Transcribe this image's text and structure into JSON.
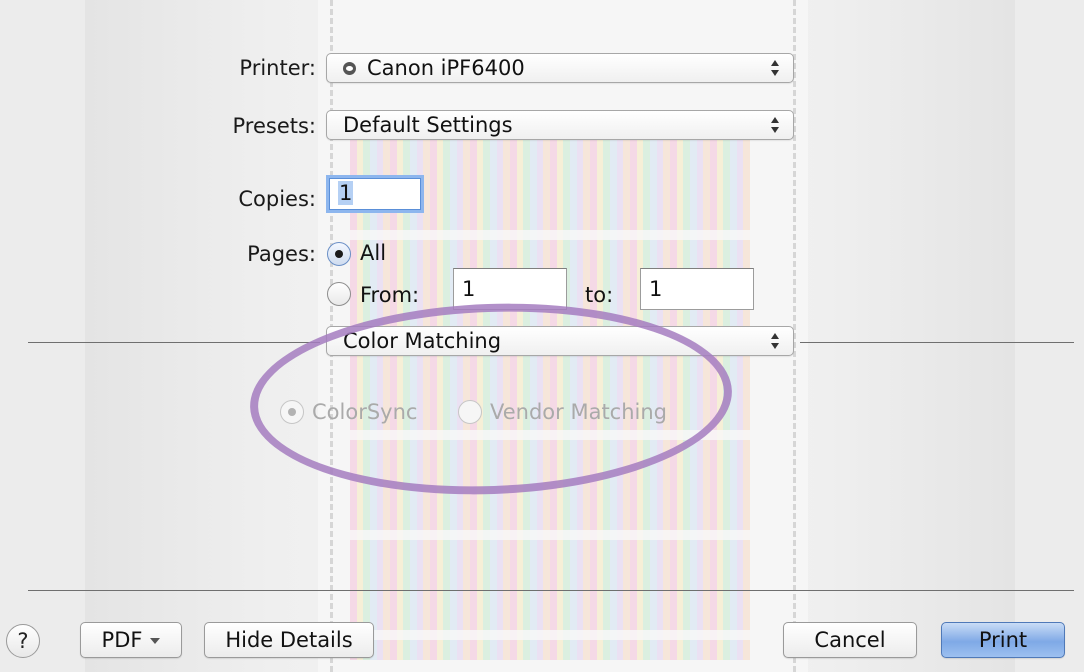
{
  "printer": {
    "label": "Printer:",
    "value": "Canon iPF6400",
    "icon": "printer-status-icon"
  },
  "presets": {
    "label": "Presets:",
    "value": "Default Settings"
  },
  "copies": {
    "label": "Copies:",
    "value": "1"
  },
  "pages": {
    "label": "Pages:",
    "all_label": "All",
    "from_label": "From:",
    "from_value": "1",
    "to_label": "to:",
    "to_value": "1",
    "selected": "All"
  },
  "panel": {
    "value": "Color Matching"
  },
  "color_matching": {
    "options": [
      "ColorSync",
      "Vendor Matching"
    ],
    "selected": "ColorSync",
    "enabled": false
  },
  "annotation": {
    "color": "#a57cc0"
  },
  "footer": {
    "help_label": "?",
    "pdf_label": "PDF",
    "hide_details_label": "Hide Details",
    "cancel_label": "Cancel",
    "print_label": "Print"
  },
  "colors": {
    "default_button": "#7fa9e6",
    "focus_ring": "#8db6ee"
  }
}
